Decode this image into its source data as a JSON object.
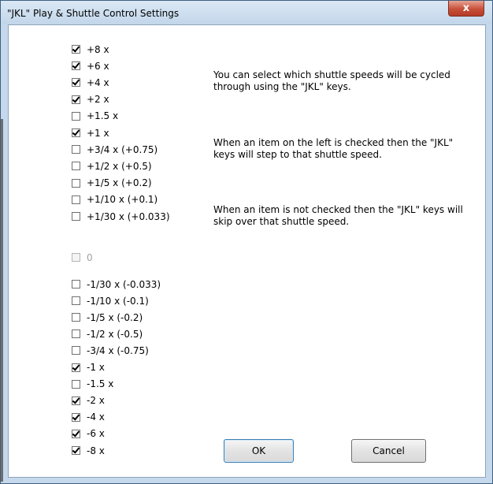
{
  "window": {
    "title": "\"JKL\" Play & Shuttle Control Settings",
    "close_glyph": "x"
  },
  "speeds": [
    {
      "label": "+8 x",
      "checked": true
    },
    {
      "label": "+6 x",
      "checked": true
    },
    {
      "label": "+4 x",
      "checked": true
    },
    {
      "label": "+2 x",
      "checked": true
    },
    {
      "label": "+1.5 x",
      "checked": false
    },
    {
      "label": "+1 x",
      "checked": true
    },
    {
      "label": "+3/4 x (+0.75)",
      "checked": false
    },
    {
      "label": "+1/2 x (+0.5)",
      "checked": false
    },
    {
      "label": "+1/5 x (+0.2)",
      "checked": false
    },
    {
      "label": "+1/10 x (+0.1)",
      "checked": false
    },
    {
      "label": "+1/30 x (+0.033)",
      "checked": false
    },
    {
      "label": "0",
      "checked": false,
      "disabled": true
    },
    {
      "label": "-1/30 x (-0.033)",
      "checked": false
    },
    {
      "label": "-1/10 x (-0.1)",
      "checked": false
    },
    {
      "label": "-1/5 x (-0.2)",
      "checked": false
    },
    {
      "label": "-1/2 x (-0.5)",
      "checked": false
    },
    {
      "label": "-3/4 x (-0.75)",
      "checked": false
    },
    {
      "label": "-1 x",
      "checked": true
    },
    {
      "label": "-1.5 x",
      "checked": false
    },
    {
      "label": "-2 x",
      "checked": true
    },
    {
      "label": "-4 x",
      "checked": true
    },
    {
      "label": "-6 x",
      "checked": true
    },
    {
      "label": "-8 x",
      "checked": true
    }
  ],
  "help": {
    "p1": "You can select which shuttle speeds will be cycled through using the \"JKL\" keys.",
    "p2": "When an item on the left is checked then the \"JKL\" keys will step to that shuttle speed.",
    "p3": "When an item is not checked then the \"JKL\" keys will skip over that shuttle speed."
  },
  "buttons": {
    "ok": "OK",
    "cancel": "Cancel"
  }
}
